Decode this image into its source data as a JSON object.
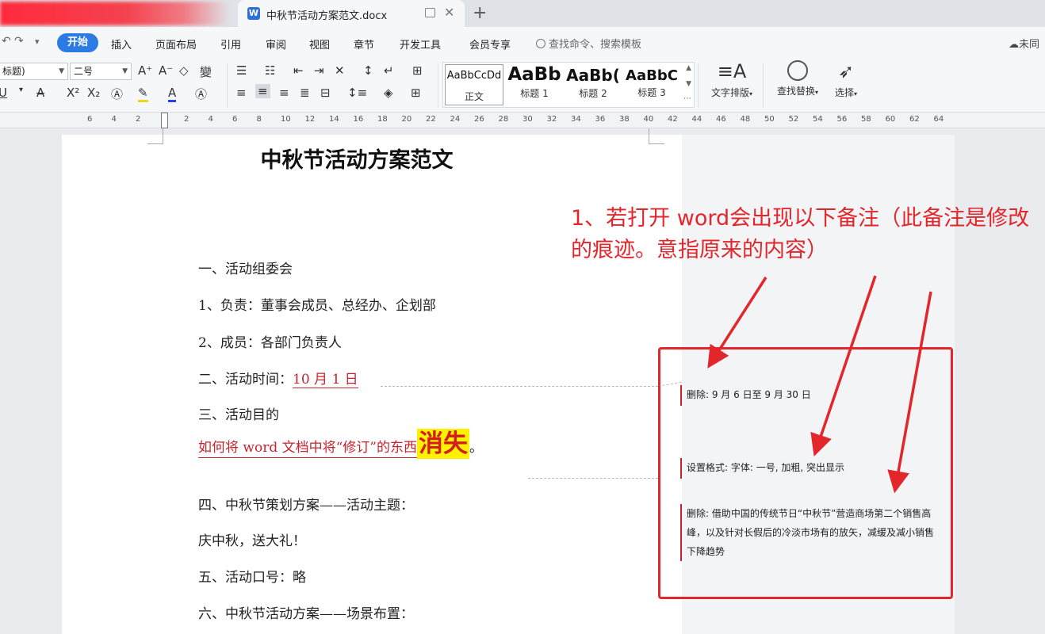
{
  "tabs": {
    "doc_title": "中秋节活动方案范文.docx",
    "new_tab": "+"
  },
  "menu": {
    "items": [
      "开始",
      "插入",
      "页面布局",
      "引用",
      "审阅",
      "视图",
      "章节",
      "开发工具",
      "会员专享"
    ],
    "search_placeholder": "查找命令、搜索模板",
    "cloud_label": "未同"
  },
  "ribbon": {
    "font_name": "标题)",
    "font_size": "二号",
    "styles": [
      {
        "sample": "AaBbCcDd",
        "name": "正文"
      },
      {
        "sample": "AaBb",
        "name": "标题 1"
      },
      {
        "sample": "AaBb(",
        "name": "标题 2"
      },
      {
        "sample": "AaBbC",
        "name": "标题 3"
      }
    ],
    "text_layout": "文字排版",
    "find_replace": "查找替换",
    "select": "选择"
  },
  "ruler": {
    "numbers": [
      "6",
      "4",
      "2",
      "",
      "2",
      "4",
      "6",
      "8",
      "10",
      "12",
      "14",
      "16",
      "18",
      "20",
      "22",
      "24",
      "26",
      "28",
      "30",
      "32",
      "34",
      "36",
      "38",
      "40",
      "42",
      "44",
      "46",
      "48",
      "50",
      "52",
      "54",
      "56",
      "58",
      "60",
      "62",
      "64"
    ]
  },
  "document": {
    "title": "中秋节活动方案范文",
    "lines": {
      "l1": "一、活动组委会",
      "l2": "1、负责：董事会成员、总经办、企划部",
      "l3": "2、成员：各部门负责人",
      "l4_prefix": "二、活动时间：",
      "l4_inserted": "10 月 1 日",
      "l5": "三、活动目的",
      "l6_text": "如何将 word 文档中将“修订”的东西",
      "l6_emph": "消失",
      "l6_end": "。",
      "l7": "四、中秋节策划方案——活动主题：",
      "l8": "庆中秋，送大礼！",
      "l9": "五、活动口号：略",
      "l10": "六、中秋节活动方案——场景布置："
    }
  },
  "balloons": {
    "b1": "删除: 9 月 6 日至 9 月 30 日",
    "b2": "设置格式: 字体: 一号, 加粗, 突出显示",
    "b3": "删除: 借助中国的传统节日“中秋节”营造商场第二个销售高峰，以及针对长假后的冷淡市场有的放矢，减缓及减小销售下降趋势"
  },
  "annotation": {
    "text": "1、若打开 word会出现以下备注（此备注是修改的痕迹。意指原来的内容）",
    "color": "#e3262b"
  },
  "colors": {
    "accent_blue": "#2c7be5",
    "revision_red": "#c8232c",
    "highlight_yellow": "#fff200"
  }
}
